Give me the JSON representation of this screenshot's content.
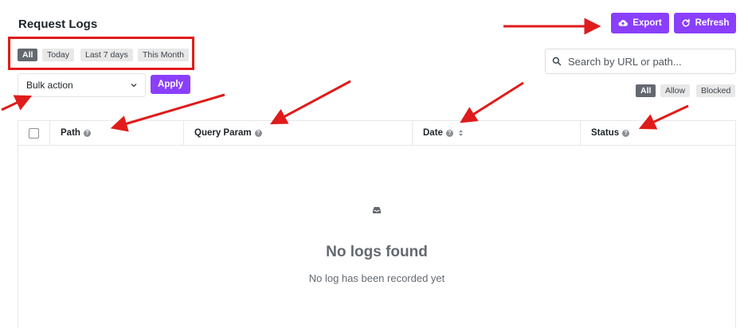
{
  "page": {
    "title": "Request Logs"
  },
  "actions": {
    "export_label": "Export",
    "refresh_label": "Refresh"
  },
  "date_filters": [
    {
      "label": "All",
      "active": true
    },
    {
      "label": "Today",
      "active": false
    },
    {
      "label": "Last 7 days",
      "active": false
    },
    {
      "label": "This Month",
      "active": false
    }
  ],
  "search": {
    "placeholder": "Search by URL or path...",
    "value": ""
  },
  "bulk": {
    "selected": "Bulk action",
    "apply_label": "Apply"
  },
  "status_filters": [
    {
      "label": "All",
      "active": true
    },
    {
      "label": "Allow",
      "active": false
    },
    {
      "label": "Blocked",
      "active": false
    }
  ],
  "table": {
    "columns": [
      "Path",
      "Query Param",
      "Date",
      "Status"
    ],
    "help_glyph": "?"
  },
  "empty": {
    "title": "No logs found",
    "subtitle": "No log has been recorded yet"
  },
  "colors": {
    "primary": "#8a3ffc",
    "annotation": "#e01b1b",
    "chip_active": "#646970"
  },
  "icons": [
    "cloud-upload-icon",
    "refresh-icon",
    "search-icon",
    "chevron-down-icon",
    "help-icon",
    "sort-icon",
    "inbox-icon",
    "arrow-icon"
  ]
}
